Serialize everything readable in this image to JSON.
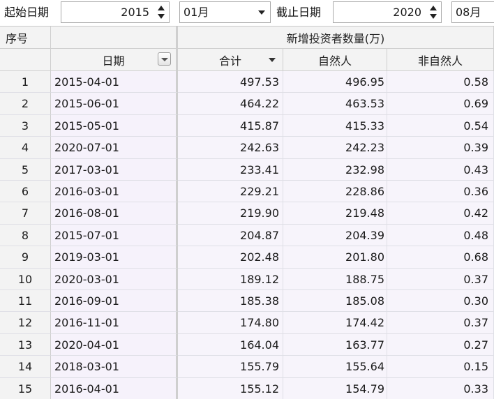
{
  "toolbar": {
    "start_label": "起始日期",
    "start_year": "2015",
    "start_month": "01月",
    "end_label": "截止日期",
    "end_year": "2020",
    "end_month": "08月"
  },
  "grid": {
    "header": {
      "index": "序号",
      "group": "新增投资者数量(万)",
      "date": "日期",
      "total": "合计",
      "natural": "自然人",
      "non_natural": "非自然人"
    },
    "rows": [
      {
        "idx": "1",
        "date": "2015-04-01",
        "total": "497.53",
        "natural": "496.95",
        "non_natural": "0.58"
      },
      {
        "idx": "2",
        "date": "2015-06-01",
        "total": "464.22",
        "natural": "463.53",
        "non_natural": "0.69"
      },
      {
        "idx": "3",
        "date": "2015-05-01",
        "total": "415.87",
        "natural": "415.33",
        "non_natural": "0.54"
      },
      {
        "idx": "4",
        "date": "2020-07-01",
        "total": "242.63",
        "natural": "242.23",
        "non_natural": "0.39"
      },
      {
        "idx": "5",
        "date": "2017-03-01",
        "total": "233.41",
        "natural": "232.98",
        "non_natural": "0.43"
      },
      {
        "idx": "6",
        "date": "2016-03-01",
        "total": "229.21",
        "natural": "228.86",
        "non_natural": "0.36"
      },
      {
        "idx": "7",
        "date": "2016-08-01",
        "total": "219.90",
        "natural": "219.48",
        "non_natural": "0.42"
      },
      {
        "idx": "8",
        "date": "2015-07-01",
        "total": "204.87",
        "natural": "204.39",
        "non_natural": "0.48"
      },
      {
        "idx": "9",
        "date": "2019-03-01",
        "total": "202.48",
        "natural": "201.80",
        "non_natural": "0.68"
      },
      {
        "idx": "10",
        "date": "2020-03-01",
        "total": "189.12",
        "natural": "188.75",
        "non_natural": "0.37"
      },
      {
        "idx": "11",
        "date": "2016-09-01",
        "total": "185.38",
        "natural": "185.08",
        "non_natural": "0.30"
      },
      {
        "idx": "12",
        "date": "2016-11-01",
        "total": "174.80",
        "natural": "174.42",
        "non_natural": "0.37"
      },
      {
        "idx": "13",
        "date": "2020-04-01",
        "total": "164.04",
        "natural": "163.77",
        "non_natural": "0.27"
      },
      {
        "idx": "14",
        "date": "2018-03-01",
        "total": "155.79",
        "natural": "155.64",
        "non_natural": "0.15"
      },
      {
        "idx": "15",
        "date": "2016-04-01",
        "total": "155.12",
        "natural": "154.79",
        "non_natural": "0.33"
      }
    ]
  }
}
